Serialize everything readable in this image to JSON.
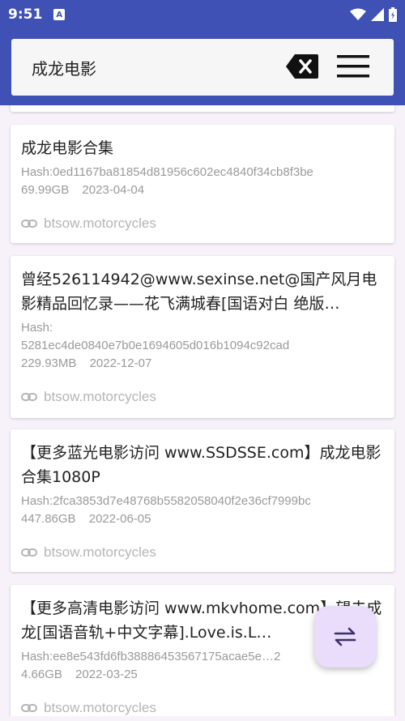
{
  "status_bar": {
    "time": "9:51",
    "notification_badge": "A"
  },
  "search": {
    "query": "成龙电影"
  },
  "results": [
    {
      "title": "成龙电影合集",
      "hash": "Hash:0ed1167ba81854d81956c602ec4840f34cb8f3be",
      "size": "69.99GB",
      "date": "2023-04-04",
      "source": "btsow.motorcycles"
    },
    {
      "title": "曾经526114942@www.sexinse.net@国产风月电影精品回忆录——花飞满城春[国语对白 绝版…",
      "hash": "Hash:\n5281ec4de0840e7b0e1694605d016b1094c92cad",
      "size": "229.93MB",
      "date": "2022-12-07",
      "source": "btsow.motorcycles"
    },
    {
      "title": "【更多蓝光电影访问 www.SSDSSE.com】成龙电影合集1080P",
      "hash": "Hash:2fca3853d7e48768b5582058040f2e36cf7999bc",
      "size": "447.86GB",
      "date": "2022-06-05",
      "source": "btsow.motorcycles"
    },
    {
      "title": "【更多高清电影访问 www.mkvhome.com】望夫成龙[国语音轨+中文字幕].Love.is.L…",
      "hash": "Hash:ee8e543fd6fb38886453567175acae5e…2",
      "size": "4.66GB",
      "date": "2022-03-25",
      "source": "btsow.motorcycles"
    }
  ],
  "colors": {
    "primary": "#3f51b5",
    "fab_bg": "#eadcfb",
    "fab_icon": "#3a2f6b",
    "muted_text": "#9a9a9a"
  },
  "icons": {
    "clear": "backspace-clear-icon",
    "menu": "hamburger-menu-icon",
    "link": "link-icon",
    "fab": "swap-horizontal-icon"
  }
}
